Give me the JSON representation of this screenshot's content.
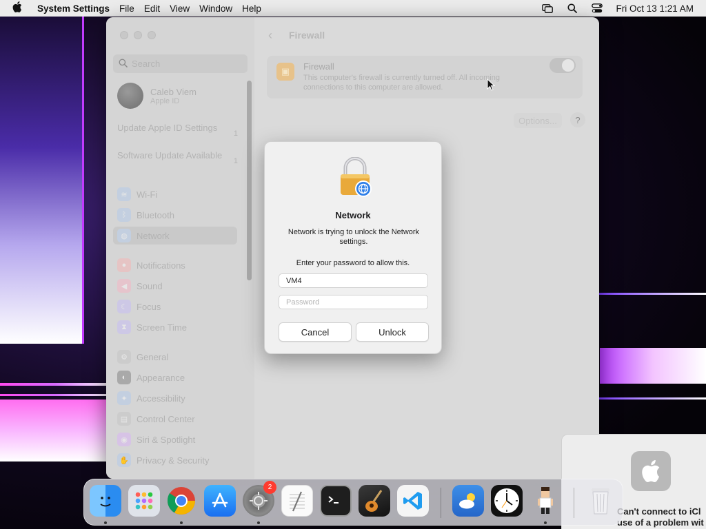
{
  "menubar": {
    "app_name": "System Settings",
    "menus": [
      "File",
      "Edit",
      "View",
      "Window",
      "Help"
    ],
    "clock": "Fri Oct 13  1:21 AM"
  },
  "sidebar": {
    "search_placeholder": "Search",
    "account": {
      "name": "Caleb Viem",
      "subtitle": "Apple ID"
    },
    "notices": [
      {
        "label": "Update Apple ID Settings",
        "badge": "1"
      },
      {
        "label": "Software Update Available",
        "badge": "1"
      }
    ],
    "items": [
      {
        "label": "Wi-Fi",
        "icon": "wifi-icon",
        "color": "#5b9cf0"
      },
      {
        "label": "Bluetooth",
        "icon": "bluetooth-icon",
        "color": "#5b9cf0"
      },
      {
        "label": "Network",
        "icon": "globe-icon",
        "color": "#5b9cf0"
      },
      {
        "label": "Notifications",
        "icon": "bell-icon",
        "color": "#f06b6b"
      },
      {
        "label": "Sound",
        "icon": "speaker-icon",
        "color": "#f06b8a"
      },
      {
        "label": "Focus",
        "icon": "moon-icon",
        "color": "#8a7ef0"
      },
      {
        "label": "Screen Time",
        "icon": "hourglass-icon",
        "color": "#8a7ef0"
      },
      {
        "label": "General",
        "icon": "gear-icon",
        "color": "#9a9a9a"
      },
      {
        "label": "Appearance",
        "icon": "appearance-icon",
        "color": "#555555"
      },
      {
        "label": "Accessibility",
        "icon": "accessibility-icon",
        "color": "#5b9cf0"
      },
      {
        "label": "Control Center",
        "icon": "control-center-icon",
        "color": "#9a9a9a"
      },
      {
        "label": "Siri & Spotlight",
        "icon": "siri-icon",
        "color": "#c37ef0"
      },
      {
        "label": "Privacy & Security",
        "icon": "hand-icon",
        "color": "#5b9cf0"
      }
    ]
  },
  "content": {
    "title": "Firewall",
    "firewall": {
      "title": "Firewall",
      "description": "This computer's firewall is currently turned off. All incoming connections to this computer are allowed.",
      "enabled": false
    },
    "options_label": "Options...",
    "help_label": "?"
  },
  "dialog": {
    "title": "Network",
    "message": "Network is trying to unlock the Network settings.",
    "prompt": "Enter your password to allow this.",
    "username_value": "VM4",
    "password_placeholder": "Password",
    "cancel_label": "Cancel",
    "unlock_label": "Unlock"
  },
  "notification": {
    "text_line1": "Can't connect to iCl",
    "text_line2": "use of a problem wit"
  },
  "dock": {
    "apps": [
      {
        "name": "Finder",
        "icon": "finder-icon",
        "running": true
      },
      {
        "name": "Launchpad",
        "icon": "launchpad-icon",
        "running": false
      },
      {
        "name": "Chrome",
        "icon": "chrome-icon",
        "running": true
      },
      {
        "name": "App Store",
        "icon": "app-store-icon",
        "running": false
      },
      {
        "name": "System Settings",
        "icon": "settings-icon",
        "running": true,
        "badge": "2"
      },
      {
        "name": "TextEdit",
        "icon": "textedit-icon",
        "running": false
      },
      {
        "name": "Terminal",
        "icon": "terminal-icon",
        "running": false
      },
      {
        "name": "GarageBand",
        "icon": "guitar-icon",
        "running": false
      },
      {
        "name": "VS Code",
        "icon": "vscode-icon",
        "running": false
      },
      {
        "name": "Weather",
        "icon": "weather-icon",
        "running": false
      },
      {
        "name": "Clock",
        "icon": "clock-icon",
        "running": false
      },
      {
        "name": "Game",
        "icon": "character-icon",
        "running": true
      },
      {
        "name": "Trash",
        "icon": "trash-icon",
        "running": false
      }
    ]
  }
}
